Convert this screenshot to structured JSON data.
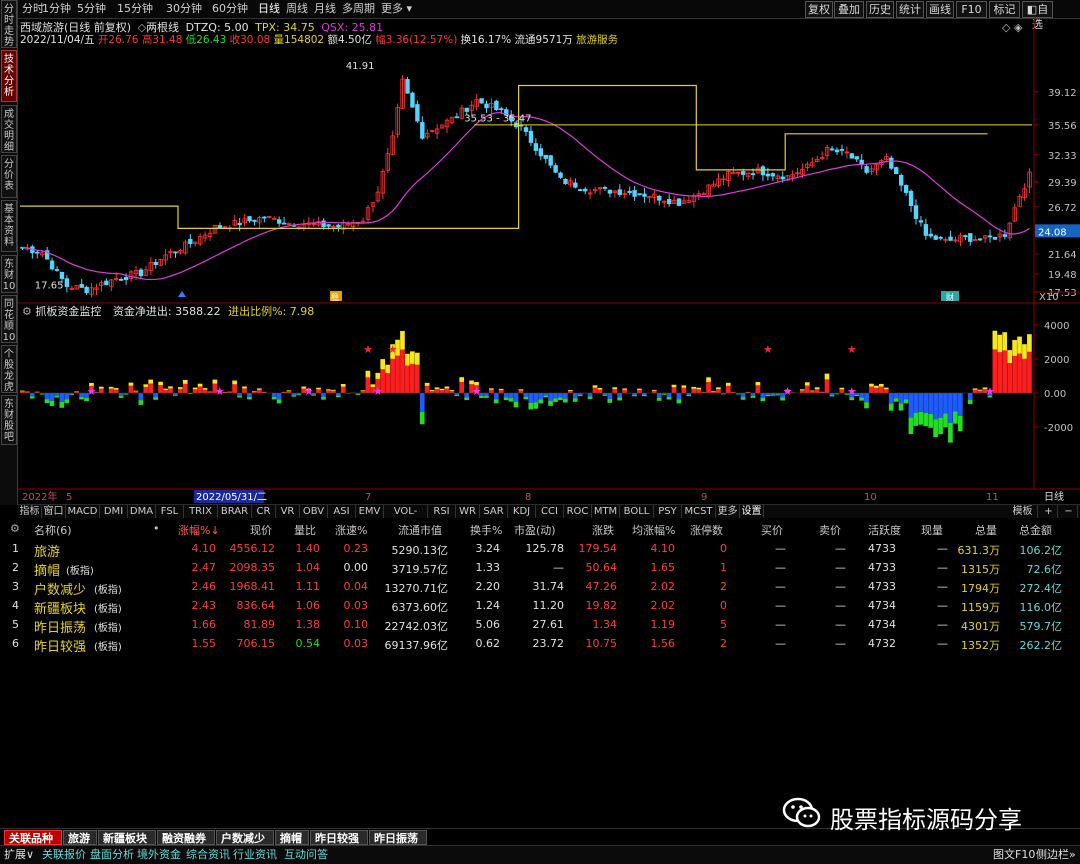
{
  "left_tabs": [
    "分时走势",
    "技术分析",
    "成交明细",
    "分价表",
    "基本资料",
    "东财10",
    "同花顺10",
    "个股龙虎",
    "东财股吧"
  ],
  "left_tab_active": 1,
  "periods": [
    "分时",
    "1分钟",
    "5分钟",
    "15分钟",
    "30分钟",
    "60分钟",
    "日线",
    "周线",
    "月线",
    "多周期",
    "更多 ▾"
  ],
  "period_selected": 6,
  "toolbar_buttons": [
    "复权",
    "叠加",
    "历史",
    "统计",
    "画线",
    "F10",
    "标记",
    "◧自选"
  ],
  "window_controls": [
    "◂",
    "▸",
    "×"
  ],
  "header1": {
    "name": "西域旅游(日线 前复权)",
    "indicator_icon": "◇",
    "indicator": "两根线",
    "dtzq": "DTZQ: 5.00",
    "tpx": "TPX: 34.75",
    "qsx": "QSX: 25.81",
    "quote_icons": "◇ ◈"
  },
  "header2": {
    "date": "2022/11/04/五",
    "open": "开26.76",
    "high": "高31.48",
    "low": "低26.43",
    "close": "收30.08",
    "vol": "量154802",
    "amount": "额4.50亿",
    "range": "幅3.36(12.57%)",
    "turnover": "换16.17%",
    "float": "流通9571万",
    "sector": "旅游服务"
  },
  "price_axis": [
    "39.12",
    "35.56",
    "32.33",
    "29.39",
    "26.72",
    "24.08",
    "21.64",
    "19.48",
    "17.53"
  ],
  "price_axis_x10": "X10",
  "price_labels": {
    "high": "41.91",
    "low": "17.65",
    "range": "35.53 - 35.47"
  },
  "markers": {
    "m1": "稳",
    "m2": "财"
  },
  "lower_header": {
    "title": "抓板资金监控",
    "net_label": "资金净进出:",
    "net_value": "3588.22",
    "ratio_label": "进出比例%:",
    "ratio_value": "7.98"
  },
  "lower_axis": [
    "4000",
    "2000",
    "0.00",
    "-2000"
  ],
  "date_axis": [
    "2022年",
    "5",
    "2022/05/31/二",
    "7",
    "8",
    "9",
    "10",
    "11"
  ],
  "date_axis_btn": "日线",
  "indicators": [
    "指标",
    "窗口",
    "MACD",
    "DMI",
    "DMA",
    "FSL",
    "TRIX",
    "BRAR",
    "CR",
    "VR",
    "OBV",
    "ASI",
    "EMV",
    "VOL-TDX",
    "RSI",
    "WR",
    "SAR",
    "KDJ",
    "CCI",
    "ROC",
    "MTM",
    "BOLL",
    "PSY",
    "MCST",
    "更多",
    "设置"
  ],
  "ind_right": [
    "模板",
    "+",
    "−"
  ],
  "table": {
    "headers": [
      "名称(6)",
      "•",
      "涨幅%↓",
      "现价",
      "量比",
      "涨速%",
      "流通市值",
      "换手%",
      "市盈(动)",
      "涨跌",
      "均涨幅%",
      "涨停数",
      "买价",
      "卖价",
      "活跃度",
      "现量",
      "总量",
      "总金额"
    ],
    "rows": [
      {
        "i": "1",
        "name": "旅游",
        "sub": "",
        "pct": "4.10",
        "price": "4556.12",
        "lb": "1.40",
        "speed": "0.23",
        "mv": "5290.13亿",
        "hs": "3.24",
        "pe": "125.78",
        "chg": "179.54",
        "avg": "4.10",
        "zt": "0",
        "bid": "—",
        "ask": "—",
        "act": "4733",
        "cur": "—",
        "tv": "631.3万",
        "amt": "106.2亿"
      },
      {
        "i": "2",
        "name": "摘帽",
        "sub": "(板指)",
        "pct": "2.47",
        "price": "2098.35",
        "lb": "1.04",
        "speed": "0.00",
        "mv": "3719.57亿",
        "hs": "1.33",
        "pe": "—",
        "chg": "50.64",
        "avg": "1.65",
        "zt": "1",
        "bid": "—",
        "ask": "—",
        "act": "4733",
        "cur": "—",
        "tv": "1315万",
        "amt": "72.6亿"
      },
      {
        "i": "3",
        "name": "户数减少",
        "sub": "(板指)",
        "pct": "2.46",
        "price": "1968.41",
        "lb": "1.11",
        "speed": "0.04",
        "mv": "13270.71亿",
        "hs": "2.20",
        "pe": "31.74",
        "chg": "47.26",
        "avg": "2.02",
        "zt": "2",
        "bid": "—",
        "ask": "—",
        "act": "4733",
        "cur": "—",
        "tv": "1794万",
        "amt": "272.4亿"
      },
      {
        "i": "4",
        "name": "新疆板块",
        "sub": "(板指)",
        "pct": "2.43",
        "price": "836.64",
        "lb": "1.06",
        "speed": "0.03",
        "mv": "6373.60亿",
        "hs": "1.24",
        "pe": "11.20",
        "chg": "19.82",
        "avg": "2.02",
        "zt": "0",
        "bid": "—",
        "ask": "—",
        "act": "4734",
        "cur": "—",
        "tv": "1159万",
        "amt": "116.0亿"
      },
      {
        "i": "5",
        "name": "昨日振荡",
        "sub": "(板指)",
        "pct": "1.66",
        "price": "81.89",
        "lb": "1.38",
        "speed": "0.10",
        "mv": "22742.03亿",
        "hs": "5.06",
        "pe": "27.61",
        "chg": "1.34",
        "avg": "1.19",
        "zt": "5",
        "bid": "—",
        "ask": "—",
        "act": "4734",
        "cur": "—",
        "tv": "4301万",
        "amt": "579.7亿"
      },
      {
        "i": "6",
        "name": "昨日较强",
        "sub": "(板指)",
        "pct": "1.55",
        "price": "706.15",
        "lb": "0.54",
        "speed": "0.03",
        "mv": "69137.96亿",
        "hs": "0.62",
        "pe": "23.72",
        "chg": "10.75",
        "avg": "1.56",
        "zt": "2",
        "bid": "—",
        "ask": "—",
        "act": "4732",
        "cur": "—",
        "tv": "1352万",
        "amt": "262.2亿"
      }
    ]
  },
  "bottom_tabs": [
    "关联品种",
    "旅游",
    "新疆板块",
    "融资融券",
    "户数减少",
    "摘帽",
    "昨日较强",
    "昨日振荡"
  ],
  "bottom_tab_selected": 0,
  "bottom_links": [
    "扩展∨",
    "关联报价",
    "盘面分析",
    "境外资金",
    "综合资讯",
    "行业资讯",
    "互动问答"
  ],
  "bottom_right": [
    "图文F10",
    "侧边栏»"
  ],
  "watermark": "股票指标源码分享",
  "colors": {
    "up": "#ff3232",
    "down": "#54d4ff",
    "ma": "#d93dd9",
    "yellow": "#e6d21e",
    "green": "#22dd22",
    "blue": "#1e5cff"
  }
}
